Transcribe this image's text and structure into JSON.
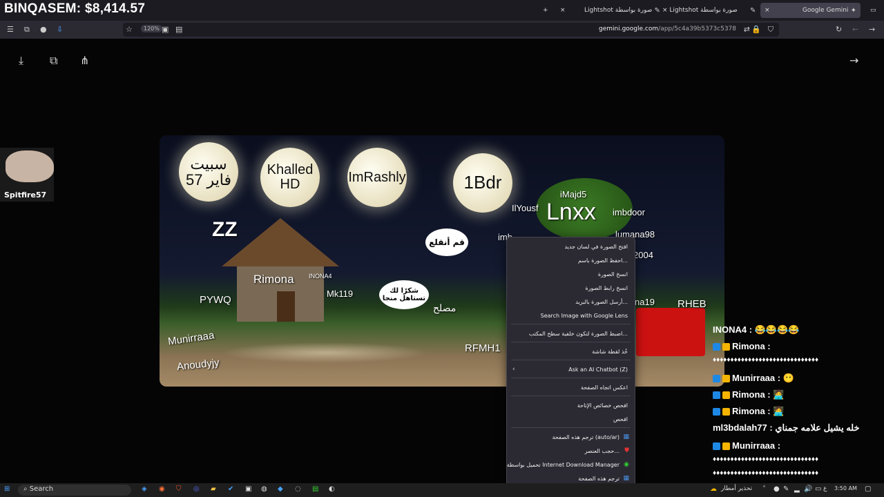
{
  "stream": {
    "title": "BINQASEM: $8,414.57"
  },
  "tabs": [
    {
      "label": "+",
      "close": "×"
    },
    {
      "label": "Lightshot صورة بواسطة",
      "close": "×"
    },
    {
      "label": "Lightshot صورة بواسطة",
      "close": ""
    },
    {
      "label": "Google Gemini",
      "close": "×"
    }
  ],
  "toolbar": {
    "zoom": "120%",
    "url_domain": "gemini.google.com",
    "url_path": "/app/5c4a39b5373c5378"
  },
  "image": {
    "moons": [
      "سبيت فاير 57",
      "Khalled HD",
      "ImRashly",
      "1Bdr"
    ],
    "labels": [
      "Lnxx",
      "iMajd5",
      "IlYousf",
      "imbdoor",
      "lumana98",
      "2004",
      "ZZ",
      "Rimona",
      "INONA4",
      "PYWQ",
      "Mk119",
      "Munirraaa",
      "Anoudyjy",
      "RFMH1",
      "RHEB",
      "na19",
      "imb"
    ],
    "bubbles": [
      "قم أنقلع",
      "شكرًا لك تستاهل منجا",
      "مصلح"
    ]
  },
  "context_menu": {
    "items": [
      "افتح الصورة في لسان جديد",
      "احفظ الصورة باسم...",
      "انسخ الصورة",
      "انسخ رابط الصورة",
      "أرسل الصورة بالبريد...",
      "Search Image with Google Lens",
      "اضبط الصورة لتكون خلفية سطح المكتب...",
      "خُذ لقطة شاشة",
      "Ask an AI Chatbot (Z)",
      "اعكس اتجاه الصفحة",
      "افحص خصائص الإتاحة",
      "افحص",
      "ترجم هذه الصفحة (auto/ar)",
      "حجب العنصر...",
      "تحميل بواسطة Internet Download Manager",
      "ترجم هذه الصفحة"
    ]
  },
  "webcam": {
    "name": "Spitfire57"
  },
  "chat": [
    {
      "user": "INONA4 :",
      "msg": "😂😂😂😂"
    },
    {
      "user": "Rimona :",
      "msg": ""
    },
    {
      "user": "",
      "msg": "♦♦♦♦♦♦♦♦♦♦♦♦♦♦♦♦♦♦♦♦♦♦♦♦♦♦♦♦♦♦"
    },
    {
      "user": "Munirraaa :",
      "msg": "😶"
    },
    {
      "user": "Rimona :",
      "msg": "🧑‍💻"
    },
    {
      "user": "Rimona :",
      "msg": "🧑‍💻"
    },
    {
      "user": "ml3bdalah77 :",
      "msg": "خله يشيل علامه جمناي"
    },
    {
      "user": "Munirraaa :",
      "msg": ""
    },
    {
      "user": "",
      "msg": "♦♦♦♦♦♦♦♦♦♦♦♦♦♦♦♦♦♦♦♦♦♦♦♦♦♦♦♦♦♦"
    },
    {
      "user": "",
      "msg": "♦♦♦♦♦♦♦♦♦♦♦♦♦♦♦♦♦♦♦♦♦♦♦♦♦♦♦♦♦♦"
    }
  ],
  "taskbar": {
    "search": "Search",
    "weather": "تحذير أمطار",
    "lang": "ع",
    "time": "3:50 AM"
  },
  "colors": {
    "accent": "#42414d",
    "menu_bg": "#2b2a33",
    "badge_blue": "#1e88e5",
    "badge_yellow": "#f4b400"
  }
}
